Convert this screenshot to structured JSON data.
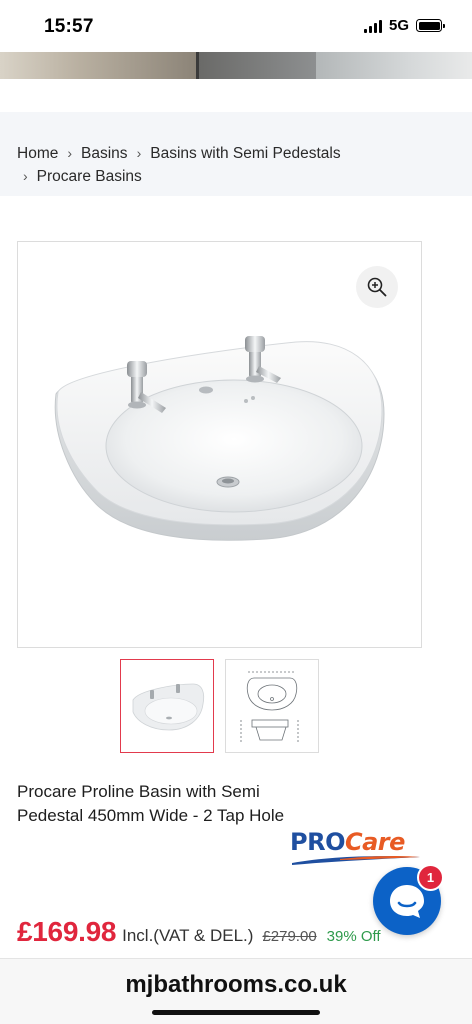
{
  "status_bar": {
    "time": "15:57",
    "network": "5G",
    "icons": [
      "signal-icon",
      "battery-icon"
    ]
  },
  "breadcrumb": {
    "items": [
      "Home",
      "Basins",
      "Basins with Semi Pedestals",
      "Procare Basins"
    ],
    "separator_icon": "chevron-right-icon"
  },
  "gallery": {
    "zoom_icon": "zoom-in-icon",
    "thumbnails": [
      "basin-photo",
      "technical-drawing"
    ],
    "active_thumbnail": 0
  },
  "product": {
    "title": "Procare Proline Basin with Semi Pedestal 450mm Wide - 2 Tap Hole",
    "brand_logo_pro": "PRO",
    "brand_logo_care": "Care"
  },
  "price": {
    "current": "£169.98",
    "incl_note": "Incl.(VAT & DEL.)",
    "was": "£279.00",
    "discount": "39% Off"
  },
  "chat": {
    "badge_count": "1",
    "icon": "chat-bubble-icon"
  },
  "browser": {
    "url": "mjbathrooms.co.uk"
  },
  "colors": {
    "accent_red": "#e0263d",
    "discount_green": "#2e9a4b",
    "chat_blue": "#0c62c7",
    "brand_blue": "#1f4fa0",
    "brand_orange": "#e85b24"
  }
}
